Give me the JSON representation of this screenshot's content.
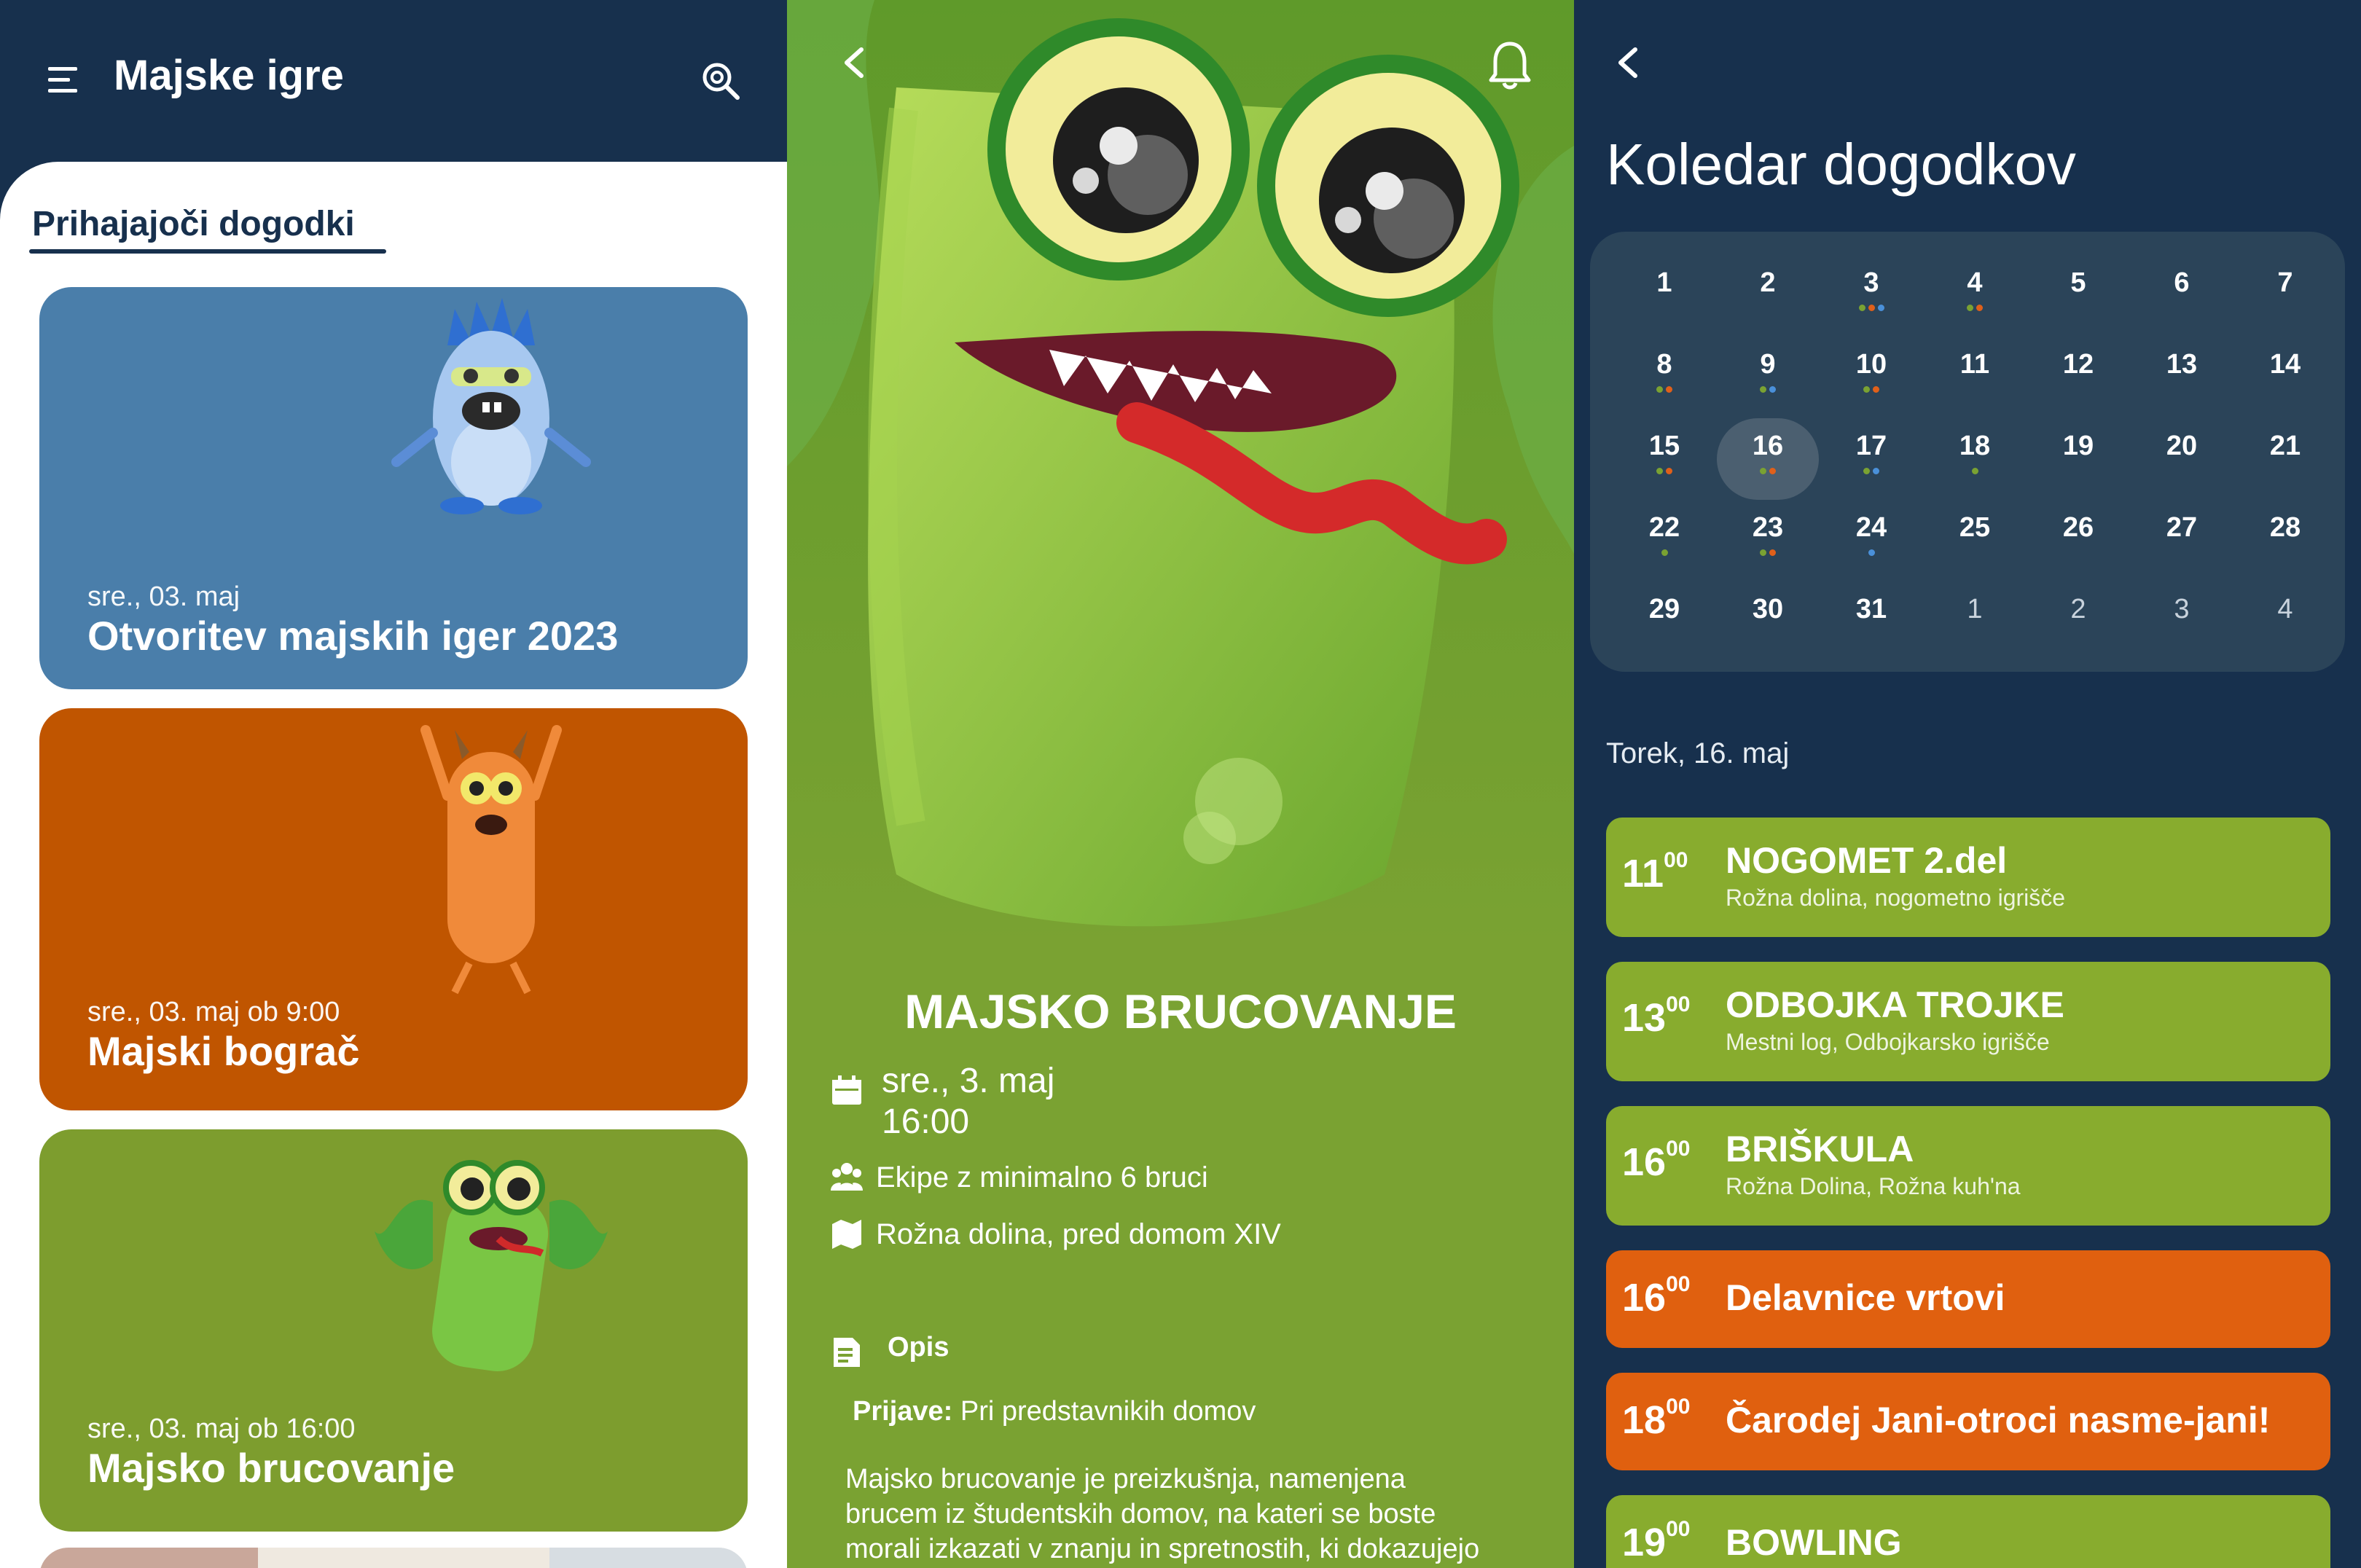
{
  "home": {
    "app_title": "Majske igre",
    "section_title": "Prihajajoči dogodki",
    "events": [
      {
        "date": "sre., 03. maj",
        "title": "Otvoritev majskih iger 2023",
        "color": "#4a7eaa"
      },
      {
        "date": "sre., 03. maj ob 9:00",
        "title": "Majski bograč",
        "color": "#c05500"
      },
      {
        "date": "sre., 03. maj ob 16:00",
        "title": "Majsko brucovanje",
        "color": "#7d9d2e"
      }
    ],
    "icons": [
      "menu-icon",
      "search-icon"
    ]
  },
  "detail": {
    "title": "MAJSKO BRUCOVANJE",
    "date_line": "sre., 3. maj",
    "time_line": "16:00",
    "teams": "Ekipe z minimalno 6 bruci",
    "location": "Rožna dolina, pred domom XIV",
    "opis_label": "Opis",
    "prijave_label": "Prijave:",
    "prijave_value": " Pri predstavnikih domov",
    "description": "Majsko brucovanje je preizkušnja, namenjena brucem iz študentskih domov, na kateri se boste morali izkazati v znanju in spretnostih, ki dokazujejo",
    "icons": [
      "back-icon",
      "bell-icon",
      "calendar-icon",
      "people-icon",
      "map-icon",
      "description-icon"
    ]
  },
  "calendar": {
    "title": "Koledar dogodkov",
    "weeks": [
      [
        {
          "n": "1"
        },
        {
          "n": "2"
        },
        {
          "n": "3",
          "dots": [
            "#7aa232",
            "#e0601a",
            "#4a90d9"
          ]
        },
        {
          "n": "4",
          "dots": [
            "#7aa232",
            "#e0601a"
          ]
        },
        {
          "n": "5"
        },
        {
          "n": "6"
        },
        {
          "n": "7"
        }
      ],
      [
        {
          "n": "8",
          "dots": [
            "#7aa232",
            "#e0601a"
          ]
        },
        {
          "n": "9",
          "dots": [
            "#7aa232",
            "#4a90d9"
          ]
        },
        {
          "n": "10",
          "dots": [
            "#7aa232",
            "#e0601a"
          ]
        },
        {
          "n": "11"
        },
        {
          "n": "12"
        },
        {
          "n": "13"
        },
        {
          "n": "14"
        }
      ],
      [
        {
          "n": "15",
          "dots": [
            "#7aa232",
            "#e0601a"
          ]
        },
        {
          "n": "16",
          "sel": true,
          "dots": [
            "#7aa232",
            "#e0601a"
          ]
        },
        {
          "n": "17",
          "dots": [
            "#7aa232",
            "#4a90d9"
          ]
        },
        {
          "n": "18",
          "dots": [
            "#7aa232"
          ]
        },
        {
          "n": "19"
        },
        {
          "n": "20"
        },
        {
          "n": "21"
        }
      ],
      [
        {
          "n": "22",
          "dots": [
            "#7aa232"
          ]
        },
        {
          "n": "23",
          "dots": [
            "#7aa232",
            "#e0601a"
          ]
        },
        {
          "n": "24",
          "dots": [
            "#4a90d9"
          ]
        },
        {
          "n": "25"
        },
        {
          "n": "26"
        },
        {
          "n": "27"
        },
        {
          "n": "28"
        }
      ],
      [
        {
          "n": "29"
        },
        {
          "n": "30"
        },
        {
          "n": "31"
        },
        {
          "n": "1",
          "other": true
        },
        {
          "n": "2",
          "other": true
        },
        {
          "n": "3",
          "other": true
        },
        {
          "n": "4",
          "other": true
        }
      ]
    ],
    "selected_date_label": "Torek, 16. maj",
    "events": [
      {
        "hour": "11",
        "min": "00",
        "name": "NOGOMET 2.del",
        "location": "Rožna dolina, nogometno igrišče",
        "color": "#88ac2e"
      },
      {
        "hour": "13",
        "min": "00",
        "name": "ODBOJKA TROJKE",
        "location": "Mestni log, Odbojkarsko igrišče",
        "color": "#88ac2e"
      },
      {
        "hour": "16",
        "min": "00",
        "name": "BRIŠKULA",
        "location": "Rožna Dolina, Rožna kuh'na",
        "color": "#88ac2e"
      },
      {
        "hour": "16",
        "min": "00",
        "name": "Delavnice vrtovi",
        "location": "",
        "color": "#e0600f"
      },
      {
        "hour": "18",
        "min": "00",
        "name": "Čarodej Jani-otroci nasme-jani!",
        "location": "",
        "color": "#e0600f"
      },
      {
        "hour": "19",
        "min": "00",
        "name": "BOWLING",
        "location": "",
        "color": "#88ac2e"
      }
    ]
  }
}
